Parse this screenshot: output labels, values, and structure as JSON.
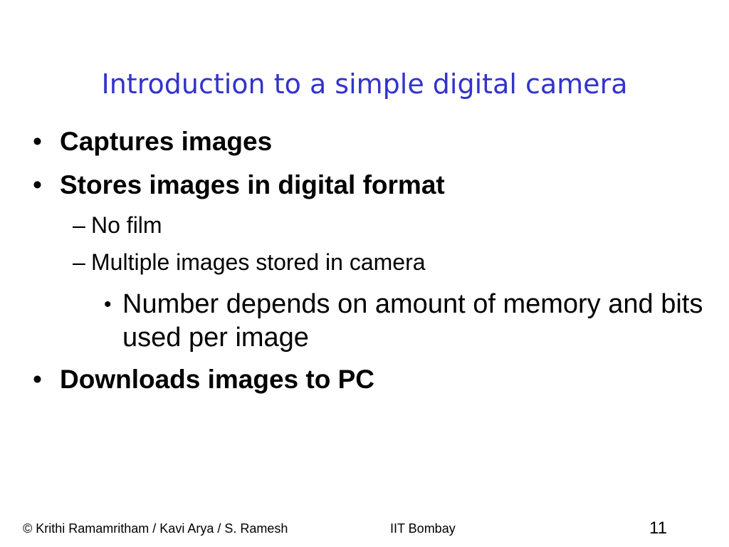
{
  "slide": {
    "title": "Introduction to a simple digital camera",
    "bullets": {
      "b1": "Captures images",
      "b2": "Stores images in digital format",
      "b2_sub1": "No film",
      "b2_sub2": "Multiple images stored in camera",
      "b2_sub2_sub1": "Number depends on amount of memory and bits used per image",
      "b3": "Downloads images to PC"
    },
    "bullet_glyph": "•",
    "dash_glyph": "–"
  },
  "footer": {
    "authors": "©  Krithi Ramamritham / Kavi Arya / S. Ramesh",
    "institution": "IIT Bombay",
    "page_number": "11"
  },
  "colors": {
    "title": "#3333cc",
    "text": "#000000",
    "background": "#ffffff"
  }
}
